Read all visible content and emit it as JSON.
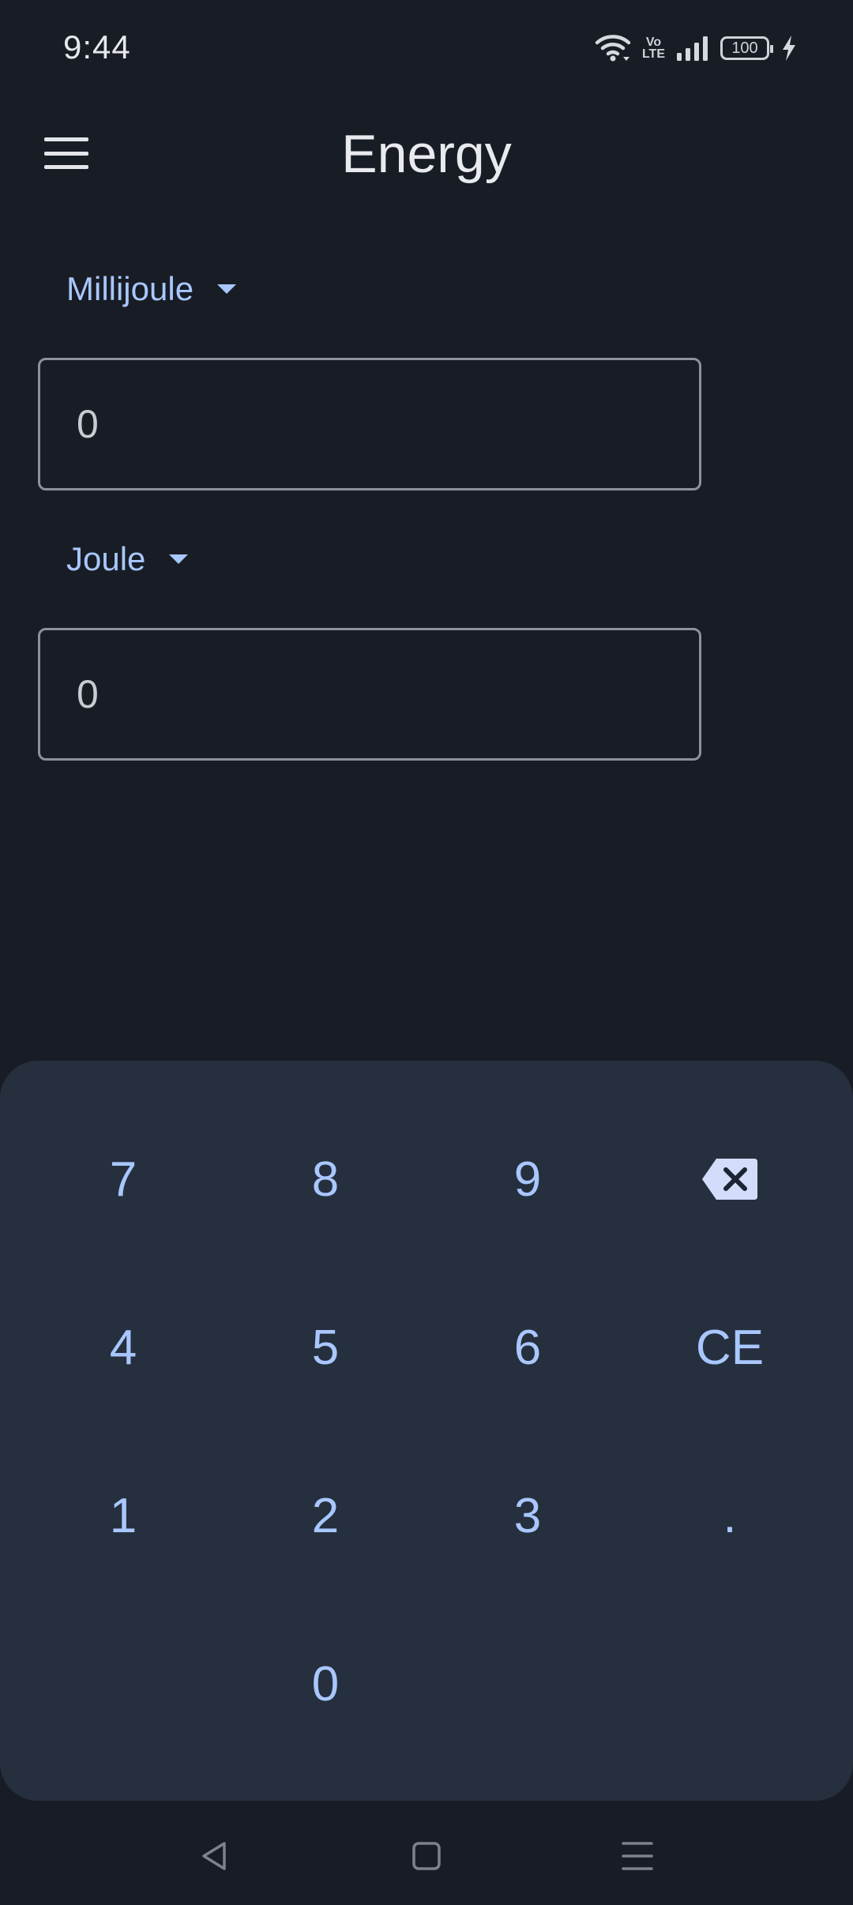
{
  "status_bar": {
    "time": "9:44",
    "battery_level": "100",
    "network_label_top": "Vo",
    "network_label_bottom": "LTE",
    "icons": [
      "wifi-icon",
      "volte-icon",
      "signal-icon",
      "battery-icon",
      "charging-icon"
    ]
  },
  "app_bar": {
    "title": "Energy",
    "menu_icon": "hamburger-menu-icon"
  },
  "converter": {
    "from_unit": "Millijoule",
    "from_value": "0",
    "to_unit": "Joule",
    "to_value": "0"
  },
  "keypad": {
    "keys": {
      "k7": "7",
      "k8": "8",
      "k9": "9",
      "k4": "4",
      "k5": "5",
      "k6": "6",
      "ce": "CE",
      "k1": "1",
      "k2": "2",
      "k3": "3",
      "dot": ".",
      "k0": "0"
    },
    "backspace_icon": "backspace-icon"
  },
  "colors": {
    "background": "#181d25",
    "keypad_background": "#262f3e",
    "accent": "#a9c7ff",
    "field_border": "#8e9199"
  },
  "nav_bar": {
    "icons": [
      "back-icon",
      "home-icon",
      "recents-icon"
    ]
  }
}
